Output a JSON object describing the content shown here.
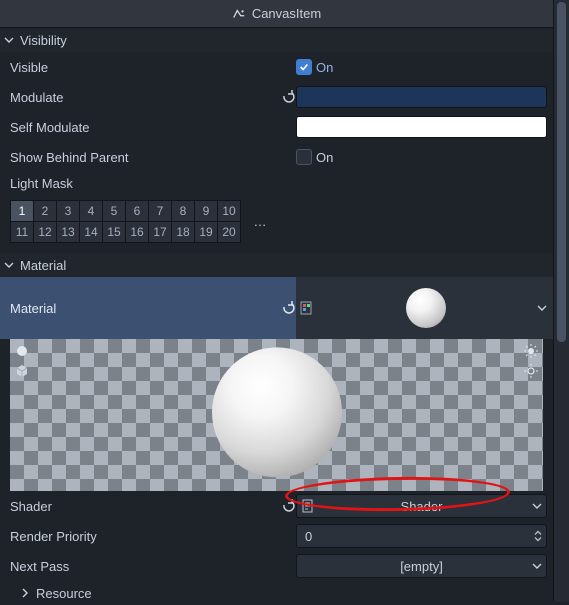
{
  "header": {
    "title": "CanvasItem"
  },
  "sections": {
    "visibility": {
      "title": "Visibility",
      "visible": {
        "label": "Visible",
        "state_text": "On",
        "checked": true
      },
      "modulate": {
        "label": "Modulate",
        "color": "#1d3559"
      },
      "self_modulate": {
        "label": "Self Modulate",
        "color": "#ffffff"
      },
      "show_behind": {
        "label": "Show Behind Parent",
        "state_text": "On",
        "checked": false
      },
      "light_mask": {
        "label": "Light Mask",
        "bits": [
          "1",
          "2",
          "3",
          "4",
          "5",
          "6",
          "7",
          "8",
          "9",
          "10",
          "11",
          "12",
          "13",
          "14",
          "15",
          "16",
          "17",
          "18",
          "19",
          "20"
        ],
        "selected": [
          0
        ]
      }
    },
    "material": {
      "title": "Material",
      "material_prop": {
        "label": "Material"
      },
      "shader": {
        "label": "Shader",
        "value": "Shader"
      },
      "render_priority": {
        "label": "Render Priority",
        "value": "0"
      },
      "next_pass": {
        "label": "Next Pass",
        "value": "[empty]"
      },
      "resource": {
        "label": "Resource"
      }
    }
  },
  "more": "…"
}
